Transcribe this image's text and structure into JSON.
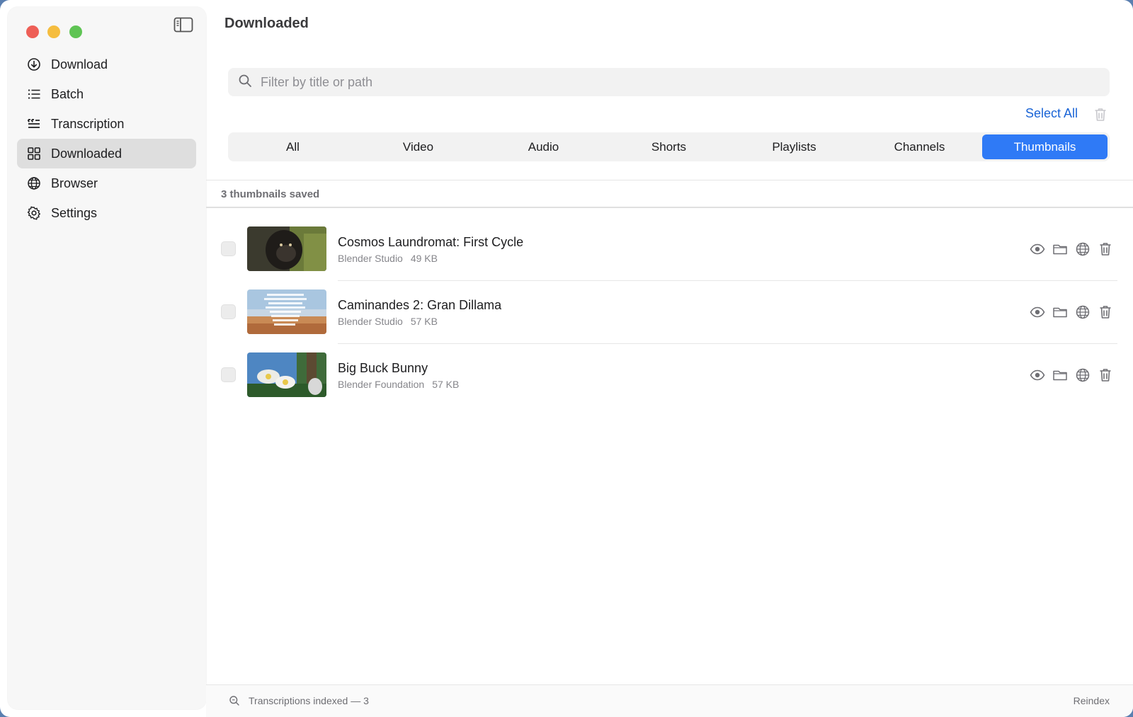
{
  "window": {
    "title": "Downloaded"
  },
  "colors": {
    "accent": "#2f7af6",
    "link": "#1a64d6",
    "sidebar_active": "#dedede"
  },
  "sidebar": {
    "items": [
      {
        "label": "Download",
        "icon": "download-circle-icon"
      },
      {
        "label": "Batch",
        "icon": "list-icon"
      },
      {
        "label": "Transcription",
        "icon": "captions-icon"
      },
      {
        "label": "Downloaded",
        "icon": "grid-icon",
        "active": true
      },
      {
        "label": "Browser",
        "icon": "globe-icon"
      },
      {
        "label": "Settings",
        "icon": "gear-icon"
      }
    ]
  },
  "search": {
    "placeholder": "Filter by title or path",
    "value": ""
  },
  "toolbar": {
    "select_all": "Select All"
  },
  "tabs": [
    {
      "label": "All"
    },
    {
      "label": "Video"
    },
    {
      "label": "Audio"
    },
    {
      "label": "Shorts"
    },
    {
      "label": "Playlists"
    },
    {
      "label": "Channels"
    },
    {
      "label": "Thumbnails",
      "active": true
    }
  ],
  "summary": {
    "count_text": "3 thumbnails saved"
  },
  "items": [
    {
      "title": "Cosmos Laundromat: First Cycle",
      "channel": "Blender Studio",
      "size": "49 KB"
    },
    {
      "title": "Caminandes 2: Gran Dillama",
      "channel": "Blender Studio",
      "size": "57 KB"
    },
    {
      "title": "Big Buck Bunny",
      "channel": "Blender Foundation",
      "size": "57 KB"
    }
  ],
  "footer": {
    "status": "Transcriptions indexed — 3",
    "reindex": "Reindex"
  }
}
